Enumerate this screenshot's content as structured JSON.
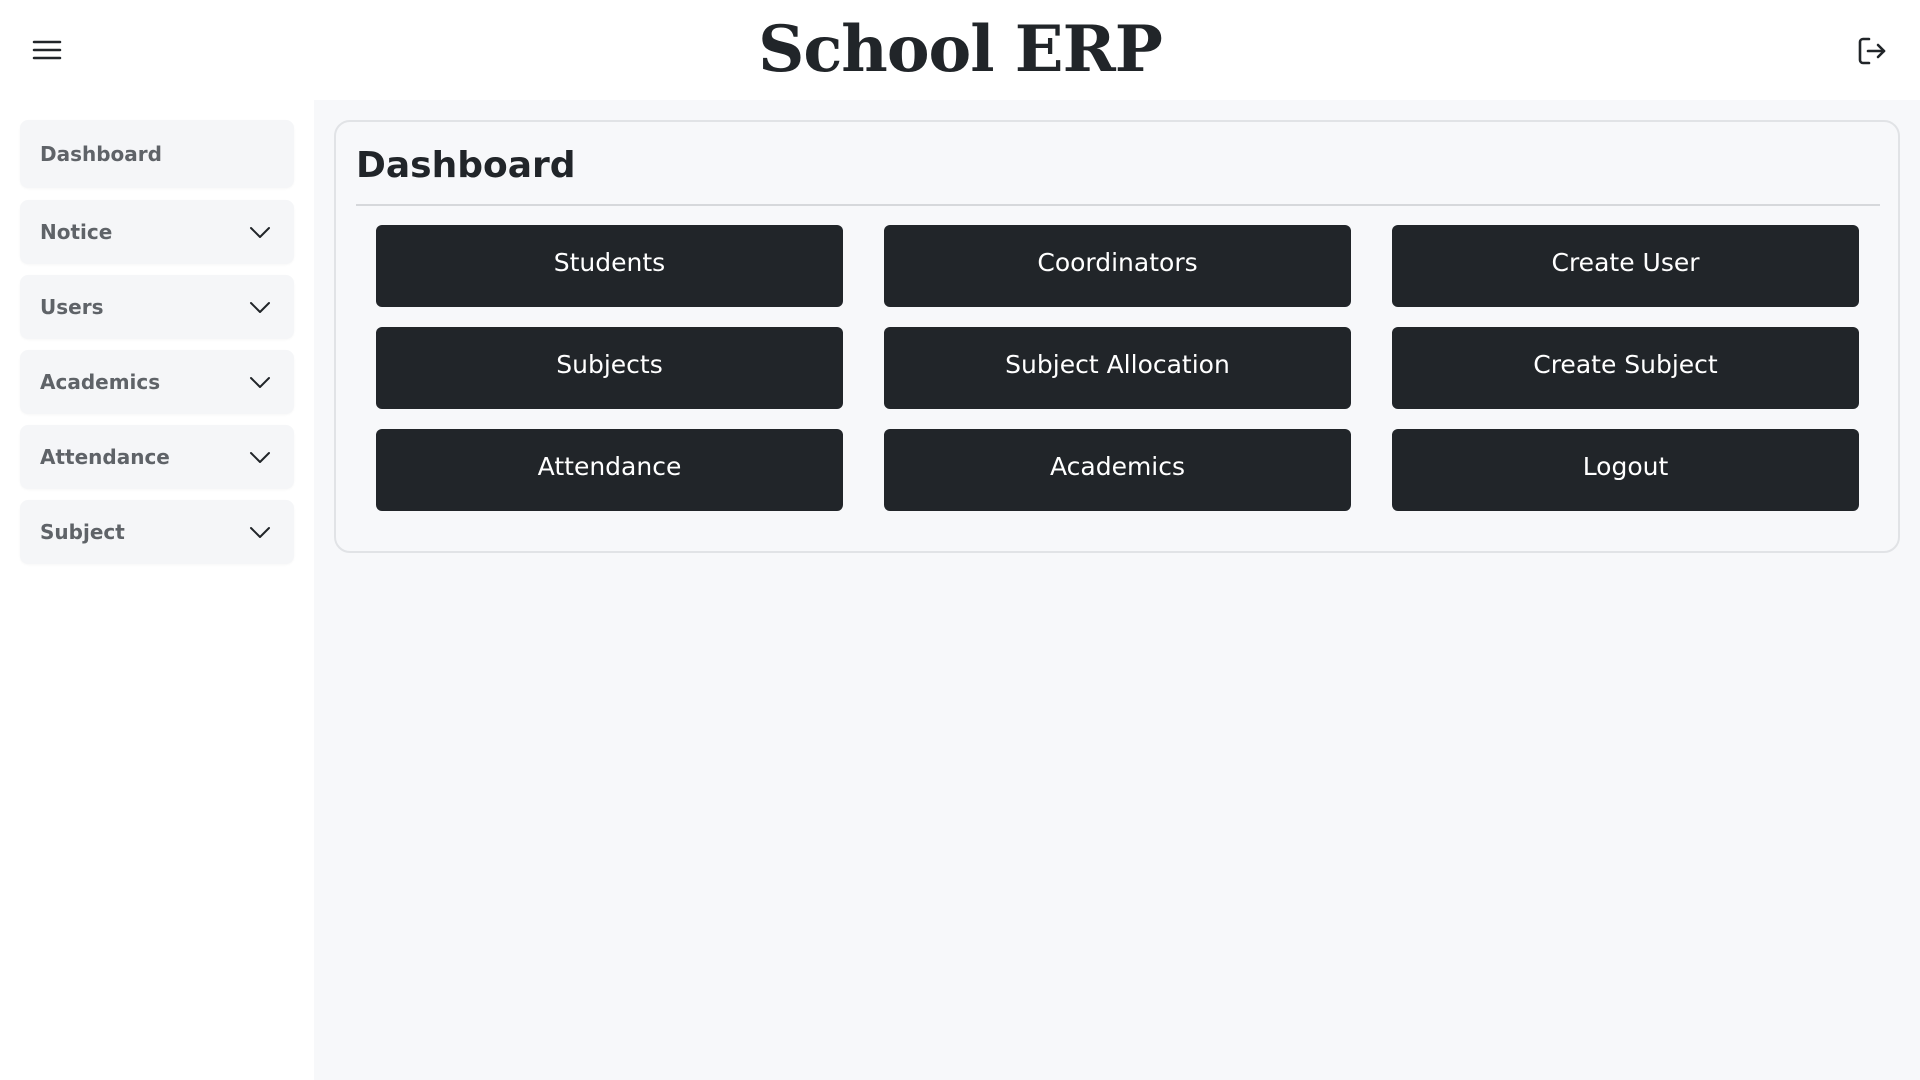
{
  "header": {
    "title": "School ERP",
    "menu_icon": "hamburger-menu-icon",
    "logout_icon": "logout-icon"
  },
  "sidebar": {
    "items": [
      {
        "label": "Dashboard",
        "has_dropdown": false
      },
      {
        "label": "Notice",
        "has_dropdown": true
      },
      {
        "label": "Users",
        "has_dropdown": true
      },
      {
        "label": "Academics",
        "has_dropdown": true
      },
      {
        "label": "Attendance",
        "has_dropdown": true
      },
      {
        "label": "Subject",
        "has_dropdown": true
      }
    ]
  },
  "main": {
    "title": "Dashboard",
    "buttons": [
      "Students",
      "Coordinators",
      "Create User",
      "Subjects",
      "Subject Allocation",
      "Create Subject",
      "Attendance",
      "Academics",
      "Logout"
    ]
  },
  "colors": {
    "button_bg": "#212529",
    "button_text": "#ffffff",
    "sidebar_item_bg": "#f5f6f8",
    "sidebar_text": "#5f6368",
    "main_bg": "#f7f8fa"
  }
}
